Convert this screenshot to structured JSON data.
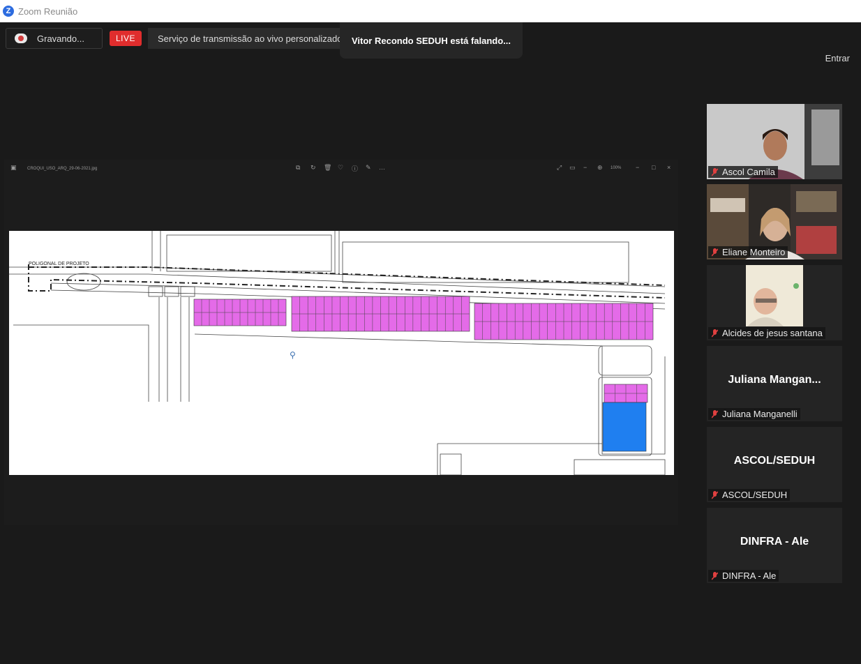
{
  "window": {
    "title": "Zoom Reunião",
    "app_icon": "zoom-logo-icon"
  },
  "topbar": {
    "recording_label": "Gravando...",
    "live_badge": "LIVE",
    "stream_label": "Serviço de transmissão ao vivo personalizado",
    "speaking_banner": "Vitor Recondo SEDUH está falando...",
    "enter_button": "Entrar"
  },
  "share": {
    "filename": "CROQUI_USO_ARQ_29-06-2021.jpg",
    "zoom_level": "100%",
    "plan_label": "POLIGONAL DE PROJETO",
    "colors": {
      "lots": "#e46be8",
      "block": "#1f7ff0"
    }
  },
  "participants": [
    {
      "name": "Ascol Camila",
      "video": true,
      "muted": true
    },
    {
      "name": "Eliane Monteiro",
      "video": true,
      "muted": true
    },
    {
      "name": "Alcides de jesus santana",
      "video": true,
      "muted": true
    },
    {
      "name": "Juliana Manganelli",
      "display": "Juliana  Mangan...",
      "video": false,
      "muted": true
    },
    {
      "name": "ASCOL/SEDUH",
      "display": "ASCOL/SEDUH",
      "video": false,
      "muted": true
    },
    {
      "name": "DINFRA - Ale",
      "display": "DINFRA - Ale",
      "video": false,
      "muted": true
    }
  ]
}
